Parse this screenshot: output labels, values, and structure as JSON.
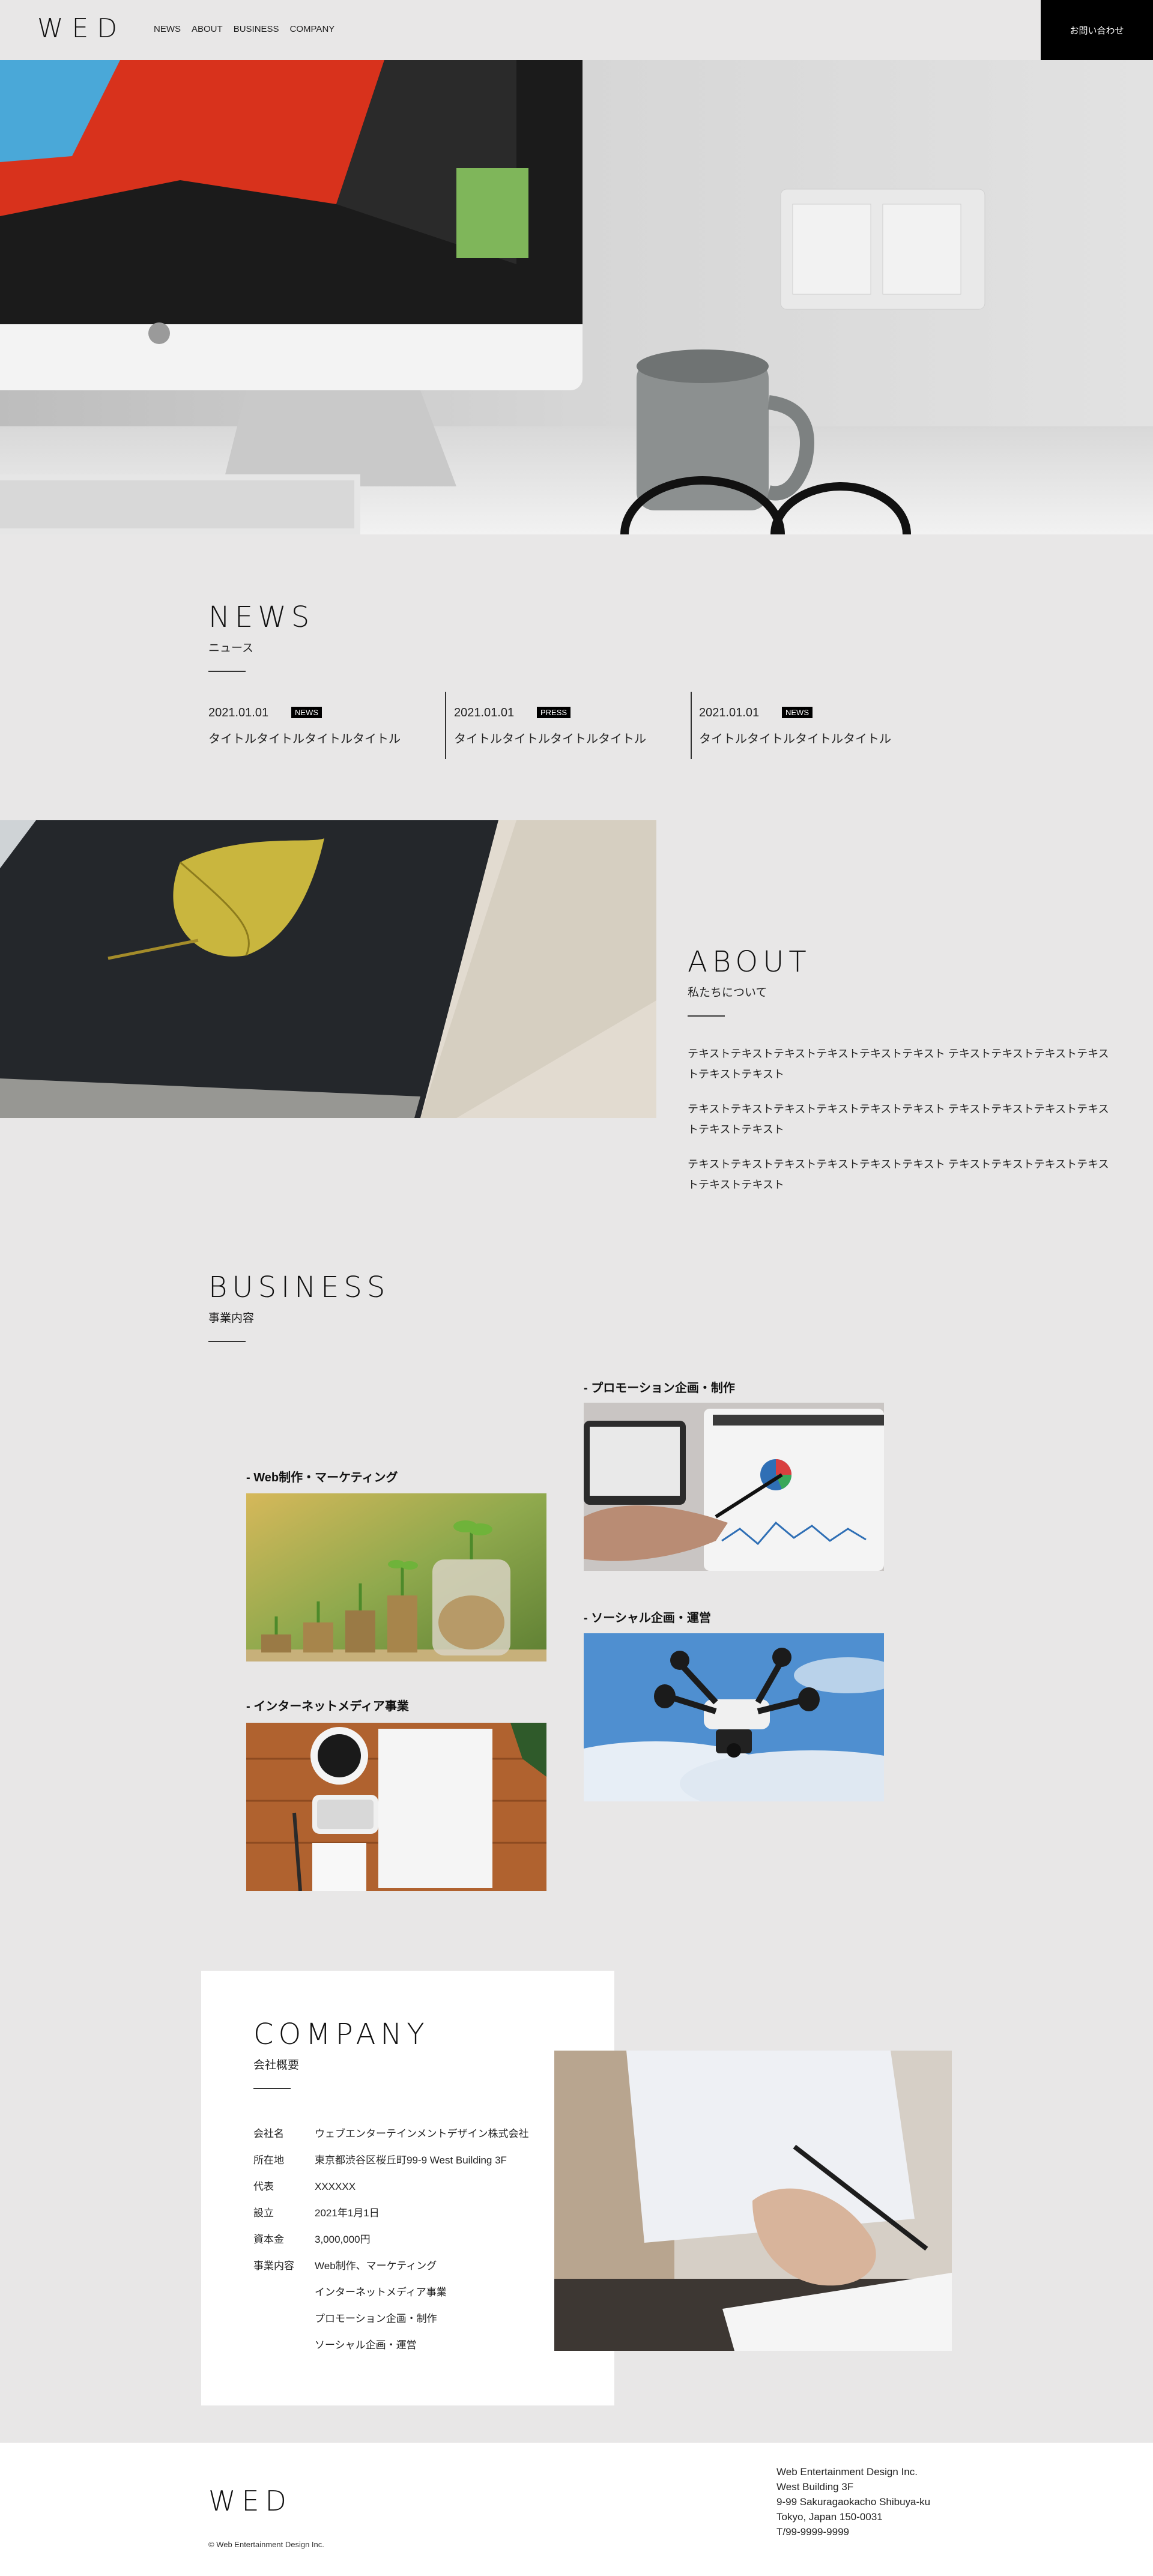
{
  "header": {
    "logo": "WED",
    "nav": [
      "NEWS",
      "ABOUT",
      "BUSINESS",
      "COMPANY"
    ],
    "contact_label": "お問い合わせ"
  },
  "news": {
    "title": "NEWS",
    "subtitle": "ニュース",
    "items": [
      {
        "date": "2021.01.01",
        "tag": "NEWS",
        "title": "タイトルタイトルタイトルタイトル"
      },
      {
        "date": "2021.01.01",
        "tag": "PRESS",
        "title": "タイトルタイトルタイトルタイトル"
      },
      {
        "date": "2021.01.01",
        "tag": "NEWS",
        "title": "タイトルタイトルタイトルタイトル"
      }
    ]
  },
  "about": {
    "title": "ABOUT",
    "subtitle": "私たちについて",
    "paragraphs": [
      "テキストテキストテキストテキストテキストテキスト テキストテキストテキストテキストテキストテキスト",
      "テキストテキストテキストテキストテキストテキスト テキストテキストテキストテキストテキストテキスト",
      "テキストテキストテキストテキストテキストテキスト テキストテキストテキストテキストテキストテキスト"
    ]
  },
  "business": {
    "title": "BUSINESS",
    "subtitle": "事業内容",
    "items": [
      {
        "label": "- プロモーション企画・制作"
      },
      {
        "label": "- Web制作・マーケティング"
      },
      {
        "label": "- ソーシャル企画・運営"
      },
      {
        "label": "- インターネットメディア事業"
      }
    ]
  },
  "company": {
    "title": "COMPANY",
    "subtitle": "会社概要",
    "rows": [
      {
        "key": "会社名",
        "value": "ウェブエンターテインメントデザイン株式会社"
      },
      {
        "key": "所在地",
        "value": "東京都渋谷区桜丘町99-9 West Building 3F"
      },
      {
        "key": "代表",
        "value": "XXXXXX"
      },
      {
        "key": "設立",
        "value": "2021年1月1日"
      },
      {
        "key": "資本金",
        "value": "3,000,000円"
      },
      {
        "key": "事業内容",
        "value": "Web制作、マーケティング"
      },
      {
        "key": "",
        "value": "インターネットメディア事業"
      },
      {
        "key": "",
        "value": "プロモーション企画・制作"
      },
      {
        "key": "",
        "value": "ソーシャル企画・運営"
      }
    ]
  },
  "footer": {
    "logo": "WED",
    "copyright": "© Web Entertainment Design Inc.",
    "address": [
      "Web Entertainment Design Inc.",
      "West Building 3F",
      "9-99 Sakuragaokacho Shibuya-ku",
      "Tokyo, Japan 150-0031",
      "T/99-9999-9999"
    ]
  }
}
